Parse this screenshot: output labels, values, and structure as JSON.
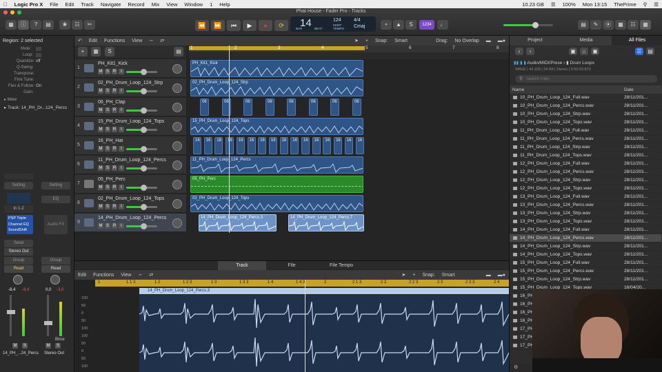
{
  "menubar": {
    "app": "Logic Pro X",
    "items": [
      "File",
      "Edit",
      "Track",
      "Navigate",
      "Record",
      "Mix",
      "View",
      "Window",
      "1",
      "Help"
    ],
    "status": {
      "storage": "10.23 GB",
      "battery": "100%",
      "clock": "Mon 13:15",
      "user": "ThePrime"
    }
  },
  "window": {
    "title": "Phat House - Fader Pro - Tracks"
  },
  "lcd": {
    "bar": "14",
    "bar_label": "BAR",
    "beat_label": "BEAT",
    "tempo": "124",
    "tempo_label": "KEEP",
    "tempo_sub": "TEMPO",
    "sig": "4/4",
    "key": "Cmaj"
  },
  "toolbar_badge": "1234",
  "inspector": {
    "region_title": "Region: 2 selected",
    "params": [
      {
        "label": "Mute:",
        "value": ""
      },
      {
        "label": "Loop:",
        "value": ""
      },
      {
        "label": "Quantize:",
        "value": "off"
      },
      {
        "label": "Q-Swing:",
        "value": ""
      },
      {
        "label": "Transpose:",
        "value": ""
      },
      {
        "label": "Fine Tune:",
        "value": ""
      },
      {
        "label": "Flex & Follow:",
        "value": "On"
      },
      {
        "label": "Gain:",
        "value": ""
      }
    ],
    "more": "More",
    "track_label": "Track:",
    "track_value": "14_PH_Dr...124_Percs",
    "strip1": {
      "setting": "Setting",
      "io": "In 1-2",
      "plugins": [
        "PSP Triple",
        "Channel EQ",
        "SoundShift"
      ],
      "send": "Send",
      "out": "Stereo Out",
      "group": "Group",
      "mode": "Read",
      "vol": "-8,4",
      "peak": "-8,4",
      "name": "14_PH_...24_Percs"
    },
    "strip2": {
      "setting": "Setting",
      "eq": "EQ",
      "fx": "Audio FX",
      "group": "Group",
      "mode": "Read",
      "vol": "0,0",
      "peak": "-3,0",
      "bnce": "Bnce",
      "name": "Stereo Out"
    }
  },
  "tracks_area": {
    "menu": [
      "Edit",
      "Functions",
      "View"
    ],
    "snap_label": "Snap:",
    "snap_value": "Smart",
    "drag_label": "Drag:",
    "drag_value": "No Overlap",
    "ruler": [
      "1",
      "2",
      "3",
      "4",
      "5",
      "6",
      "7",
      "8"
    ],
    "tracks": [
      {
        "num": "1",
        "name": "PH_Kit1_Kick",
        "level": 0.55,
        "color": "#5d6b80"
      },
      {
        "num": "2",
        "name": "02_PH_Drum_Loop_124_Strp",
        "level": 0.55,
        "color": "#5d6b80"
      },
      {
        "num": "3",
        "name": "06_PH_Clap",
        "level": 0.55,
        "color": "#5d6b80"
      },
      {
        "num": "4",
        "name": "15_PH_Drum_Loop_124_Tops",
        "level": 0.55,
        "color": "#5d6b80"
      },
      {
        "num": "5",
        "name": "16_PH_Hat",
        "level": 0.55,
        "color": "#5d6b80"
      },
      {
        "num": "6",
        "name": "11_PH_Drum_Loop_124_Percs",
        "level": 0.55,
        "color": "#5d6b80"
      },
      {
        "num": "7",
        "name": "05_PH_Perc",
        "level": 0.55,
        "color": "#777777"
      },
      {
        "num": "8",
        "name": "02_PH_Drum_Loop_124_Tops",
        "level": 0.55,
        "color": "#5d6b80"
      },
      {
        "num": "9",
        "name": "14_PH_Drum_Loop_124_Percs",
        "level": 0.55,
        "color": "#5d6b80"
      }
    ],
    "regions": {
      "r1": "PH_Kit1_Kick",
      "r2": "02_PH_Drum_Loop_124_Strp",
      "r3": "06",
      "r4": "15_PH_Drum_Loop_124_Tops",
      "r5": "16",
      "r6": "11_PH_Drum_Loop_124_Percs",
      "r7": "05_PH_Perc",
      "r8": "02_PH_Drum_Loop_124_Tops",
      "r9a": "14_PH_Drum_Loop_124_Percs.3",
      "r9b": "14_PH_Drum_Loop_124_Percs.7"
    }
  },
  "editor": {
    "tabs": [
      "Track",
      "File",
      "File Tempo"
    ],
    "menu": [
      "Edit",
      "Functions",
      "View"
    ],
    "snap_label": "Snap:",
    "snap_value": "Smart",
    "ruler": [
      "1",
      "1 1 3",
      "1 2",
      "1 2 3",
      "1 3",
      "1 3 3",
      "1 4",
      "1 4 3",
      "2",
      "2 1 3",
      "2 2",
      "2 2 3",
      "2 3",
      "2 3 3",
      "2 4"
    ],
    "region_name": "14_PH_Drum_Loop_124_Percs.3",
    "scale": [
      "100",
      "50",
      "0",
      "50",
      "100",
      "100",
      "50",
      "0",
      "50",
      "100"
    ]
  },
  "browser": {
    "tabs": [
      "Project",
      "Media",
      "All Files"
    ],
    "path": "Audio/MIDI/Prese",
    "folder": "Drum Loops",
    "info": "WAVE | 44.100 | 24 Bit | Stereo | 0:00:03.870",
    "search_placeholder": "Search Files",
    "col_name": "Name",
    "col_date": "Date",
    "files": [
      {
        "name": "10_PH_Drum_Loop_124_Full.wav",
        "date": "28/11/201..."
      },
      {
        "name": "10_PH_Drum_Loop_124_Percs.wav",
        "date": "28/11/201..."
      },
      {
        "name": "10_PH_Drum_Loop_124_Strp.wav",
        "date": "28/11/201..."
      },
      {
        "name": "10_PH_Drum_Loop_124_Tops.wav",
        "date": "28/11/201..."
      },
      {
        "name": "11_PH_Drum_Loop_124_Full.wav",
        "date": "28/11/201..."
      },
      {
        "name": "11_PH_Drum_Loop_124_Percs.wav",
        "date": "28/11/201..."
      },
      {
        "name": "11_PH_Drum_Loop_124_Strp.wav",
        "date": "28/11/201..."
      },
      {
        "name": "11_PH_Drum_Loop_124_Tops.wav",
        "date": "28/11/201..."
      },
      {
        "name": "12_PH_Drum_Loop_124_Full.wav",
        "date": "28/11/201..."
      },
      {
        "name": "12_PH_Drum_Loop_124_Percs.wav",
        "date": "28/11/201..."
      },
      {
        "name": "12_PH_Drum_Loop_124_Strp.wav",
        "date": "28/11/201..."
      },
      {
        "name": "12_PH_Drum_Loop_124_Tops.wav",
        "date": "28/11/201..."
      },
      {
        "name": "13_PH_Drum_Loop_124_Full.wav",
        "date": "28/11/201..."
      },
      {
        "name": "13_PH_Drum_Loop_124_Percs.wav",
        "date": "28/11/201..."
      },
      {
        "name": "13_PH_Drum_Loop_124_Strp.wav",
        "date": "28/11/201..."
      },
      {
        "name": "13_PH_Drum_Loop_124_Tops.wav",
        "date": "28/11/201..."
      },
      {
        "name": "14_PH_Drum_Loop_124_Full.wav",
        "date": "28/11/201..."
      },
      {
        "name": "14_PH_Drum_Loop_124_Percs.wav",
        "date": "28/11/201..."
      },
      {
        "name": "14_PH_Drum_Loop_124_Strp.wav",
        "date": "28/11/201..."
      },
      {
        "name": "14_PH_Drum_Loop_124_Tops.wav",
        "date": "28/11/201..."
      },
      {
        "name": "15_PH_Drum_Loop_124_Full.wav",
        "date": "28/11/201..."
      },
      {
        "name": "15_PH_Drum_Loop_124_Percs.wav",
        "date": "28/11/201..."
      },
      {
        "name": "15_PH_Drum_Loop_124_Strp.wav",
        "date": "28/11/201..."
      },
      {
        "name": "15_PH_Drum_Loop_124_Tops.wav",
        "date": "16/04/20..."
      },
      {
        "name": "16_PH_",
        "date": ""
      },
      {
        "name": "16_PH_",
        "date": ""
      },
      {
        "name": "16_PH_",
        "date": ""
      },
      {
        "name": "16_PH_",
        "date": ""
      },
      {
        "name": "17_PH_",
        "date": ""
      },
      {
        "name": "17_PH_",
        "date": ""
      },
      {
        "name": "17_PH_",
        "date": ""
      }
    ]
  }
}
